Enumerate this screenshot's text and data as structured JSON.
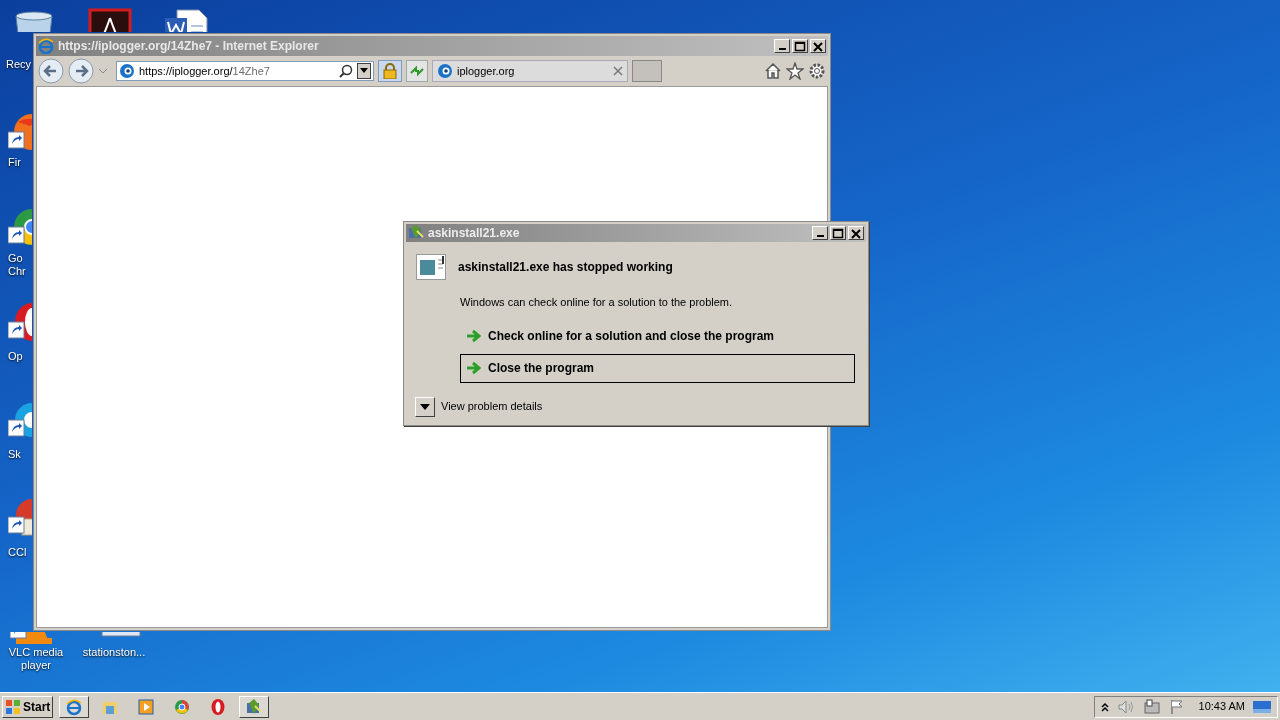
{
  "desktop": {
    "icons": [
      {
        "kind": "recycle-bin",
        "label": "Recy"
      },
      {
        "kind": "pdf"
      },
      {
        "kind": "word"
      },
      {
        "kind": "firefox",
        "label": "Fir"
      },
      {
        "kind": "chrome",
        "label": "Go\nChr"
      },
      {
        "kind": "opera",
        "label": "Op"
      },
      {
        "kind": "skype",
        "label": "Sk"
      },
      {
        "kind": "ccleaner",
        "label": "CCl"
      },
      {
        "kind": "vlc",
        "label": "VLC media player"
      },
      {
        "kind": "file",
        "label": "stationston..."
      }
    ]
  },
  "browser": {
    "title": "https://iplogger.org/14Zhe7 - Internet Explorer",
    "address_host": "https://iplogger.org/",
    "address_path": "14Zhe7",
    "tabs": [
      {
        "label": "iplogger.org",
        "selected": true
      }
    ]
  },
  "dialog": {
    "title": "askinstall21.exe",
    "heading": "askinstall21.exe has stopped working",
    "message": "Windows can check online for a solution to the problem.",
    "options": [
      {
        "label": "Check online for a solution and close the program",
        "focused": false
      },
      {
        "label": "Close the program",
        "focused": true
      }
    ],
    "details": "View problem details"
  },
  "taskbar": {
    "start": "Start",
    "items": [
      {
        "kind": "ie",
        "active": true
      },
      {
        "kind": "explorer",
        "active": false
      },
      {
        "kind": "media",
        "active": false
      },
      {
        "kind": "chrome",
        "active": false
      },
      {
        "kind": "opera",
        "active": false
      },
      {
        "kind": "crash",
        "active": true
      }
    ],
    "clock": "10:43 AM"
  }
}
